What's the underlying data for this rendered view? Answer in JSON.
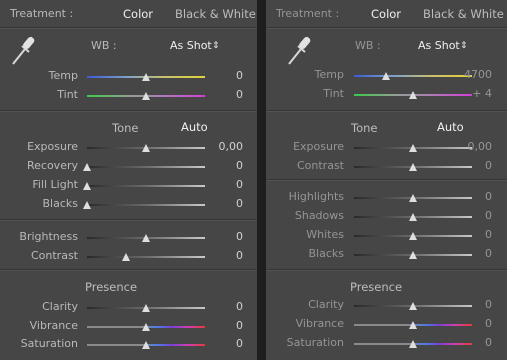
{
  "left": {
    "treatment_label": "Treatment :",
    "treatment_color": "Color",
    "treatment_bw": "Black & White",
    "wb_label": "WB :",
    "wb_value": "As Shot",
    "wb_arrow": "⇕",
    "tone_label": "Tone",
    "auto_label": "Auto",
    "presence_label": "Presence",
    "sliders": [
      {
        "label": "Temp",
        "value": "0",
        "pos": 0.5,
        "track": "temp"
      },
      {
        "label": "Tint",
        "value": "0",
        "pos": 0.5,
        "track": "tint"
      },
      {
        "label": "Exposure",
        "value": "0,00",
        "pos": 0.5,
        "track": "gray"
      },
      {
        "label": "Recovery",
        "value": "0",
        "pos": 0.0,
        "track": "gray"
      },
      {
        "label": "Fill Light",
        "value": "0",
        "pos": 0.0,
        "track": "gray"
      },
      {
        "label": "Blacks",
        "value": "0",
        "pos": 0.0,
        "track": "gray"
      },
      {
        "label": "Brightness",
        "value": "0",
        "pos": 0.5,
        "track": "gray"
      },
      {
        "label": "Contrast",
        "value": "0",
        "pos": 0.33,
        "track": "gray"
      },
      {
        "label": "Clarity",
        "value": "0",
        "pos": 0.5,
        "track": "gray"
      },
      {
        "label": "Vibrance",
        "value": "0",
        "pos": 0.5,
        "track": "spectrum"
      },
      {
        "label": "Saturation",
        "value": "0",
        "pos": 0.5,
        "track": "spectrum"
      }
    ]
  },
  "right": {
    "treatment_label": "Treatment :",
    "treatment_color": "Color",
    "treatment_bw": "Black & White",
    "wb_label": "WB :",
    "wb_value": "As Shot",
    "wb_arrow": "⇕",
    "tone_label": "Tone",
    "auto_label": "Auto",
    "presence_label": "Presence",
    "sliders": [
      {
        "label": "Temp",
        "value": "4700",
        "pos": 0.27,
        "track": "temp"
      },
      {
        "label": "Tint",
        "value": "+ 4",
        "pos": 0.5,
        "track": "tint"
      },
      {
        "label": "Exposure",
        "value": "0,00",
        "pos": 0.5,
        "track": "gray"
      },
      {
        "label": "Contrast",
        "value": "0",
        "pos": 0.5,
        "track": "gray"
      },
      {
        "label": "Highlights",
        "value": "0",
        "pos": 0.5,
        "track": "gray"
      },
      {
        "label": "Shadows",
        "value": "0",
        "pos": 0.5,
        "track": "gray"
      },
      {
        "label": "Whites",
        "value": "0",
        "pos": 0.5,
        "track": "gray"
      },
      {
        "label": "Blacks",
        "value": "0",
        "pos": 0.5,
        "track": "gray"
      },
      {
        "label": "Clarity",
        "value": "0",
        "pos": 0.5,
        "track": "gray"
      },
      {
        "label": "Vibrance",
        "value": "0",
        "pos": 0.5,
        "track": "spectrum"
      },
      {
        "label": "Saturation",
        "value": "0",
        "pos": 0.5,
        "track": "spectrum"
      }
    ]
  },
  "colors": {
    "panel_bg": "#464646",
    "highlight_text": "#f0f0f0",
    "label_text": "#b9b9b9"
  },
  "icons": {
    "eyedropper": "eyedropper-icon",
    "wb_stepper": "up-down-arrows-icon"
  }
}
